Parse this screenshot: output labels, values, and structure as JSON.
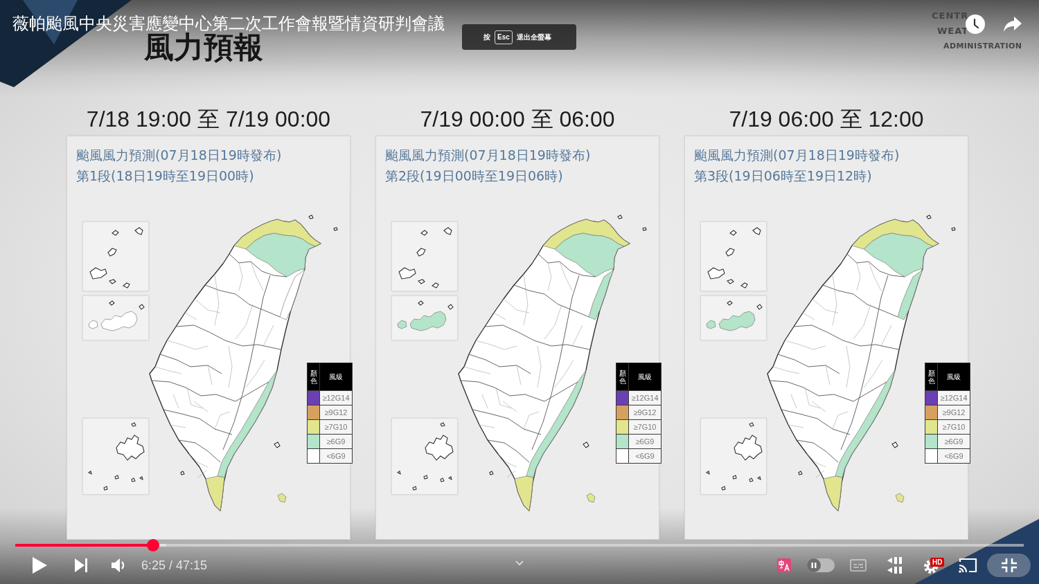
{
  "player": {
    "title": "薇帕颱風中央災害應變中心第二次工作會報暨情資研判會議",
    "esc_hint": {
      "before": "按",
      "key": "Esc",
      "after": "退出全螢幕"
    },
    "progress": {
      "level": 0.137,
      "buffer": {
        "level": 0.15
      }
    },
    "time": "6:25 / 47:15",
    "autoplay": {
      "on": false
    },
    "captions": {
      "disabled": true
    },
    "settings": {
      "badge": "HD"
    },
    "exit_fullscreen": {
      "highlighted": true
    }
  },
  "slide": {
    "heading": "風力預報",
    "logo": [
      "CENTR",
      "WEAT",
      "ADMINISTRATION"
    ],
    "panels": [
      {
        "heading": "7/18 19:00 至 7/19 00:00",
        "title": "颱風風力預測(07月18日19時發布)",
        "subtitle": "第1段(18日19時至19日00時)",
        "map": {
          "regions": [
            {
              "color": "#e1e58e"
            },
            {
              "color": "#b4e4c9"
            },
            {
              "color": "#ffffff"
            },
            {
              "color": "#b4e4c9"
            },
            {
              "color": "#e1e58e"
            },
            {
              "color": "#ffffff"
            },
            {
              "color": "#e1e58e"
            }
          ]
        },
        "legend": {
          "header": [
            "顏色",
            "風級"
          ],
          "rows": [
            {
              "label": "≥12G14",
              "color": "#6b40b2"
            },
            {
              "label": "≥9G12",
              "color": "#d6a15f"
            },
            {
              "label": "≥7G10",
              "color": "#e1e58e"
            },
            {
              "label": "≥6G9",
              "color": "#b4e4c9"
            },
            {
              "label": "<6G9",
              "color": "#ffffff"
            }
          ]
        }
      },
      {
        "heading": "7/19 00:00 至 06:00",
        "title": "颱風風力預測(07月18日19時發布)",
        "subtitle": "第2段(19日00時至19日06時)",
        "map": {
          "regions": [
            {
              "color": "#e1e58e"
            },
            {
              "color": "#b4e4c9"
            },
            {
              "color": "#b4e4c9"
            },
            {
              "color": "#b4e4c9"
            },
            {
              "color": "#e1e58e"
            },
            {
              "color": "#b4e4c9"
            },
            {
              "color": "#e1e58e"
            }
          ]
        },
        "legend": {
          "header": [
            "顏色",
            "風級"
          ],
          "rows": [
            {
              "label": "≥12G14",
              "color": "#6b40b2"
            },
            {
              "label": "≥9G12",
              "color": "#d6a15f"
            },
            {
              "label": "≥7G10",
              "color": "#e1e58e"
            },
            {
              "label": "≥6G9",
              "color": "#b4e4c9"
            },
            {
              "label": "<6G9",
              "color": "#ffffff"
            }
          ]
        }
      },
      {
        "heading": "7/19 06:00 至 12:00",
        "title": "颱風風力預測(07月18日19時發布)",
        "subtitle": "第3段(19日06時至19日12時)",
        "map": {
          "regions": [
            {
              "color": "#e1e58e"
            },
            {
              "color": "#b4e4c9"
            },
            {
              "color": "#b4e4c9"
            },
            {
              "color": "#b4e4c9"
            },
            {
              "color": "#e1e58e"
            },
            {
              "color": "#b4e4c9"
            },
            {
              "color": "#e1e58e"
            }
          ]
        },
        "legend": {
          "header": [
            "顏色",
            "風級"
          ],
          "rows": [
            {
              "label": "≥12G14",
              "color": "#6b40b2"
            },
            {
              "label": "≥9G12",
              "color": "#d6a15f"
            },
            {
              "label": "≥7G10",
              "color": "#e1e58e"
            },
            {
              "label": "≥6G9",
              "color": "#b4e4c9"
            },
            {
              "label": "<6G9",
              "color": "#ffffff"
            }
          ]
        }
      }
    ]
  }
}
